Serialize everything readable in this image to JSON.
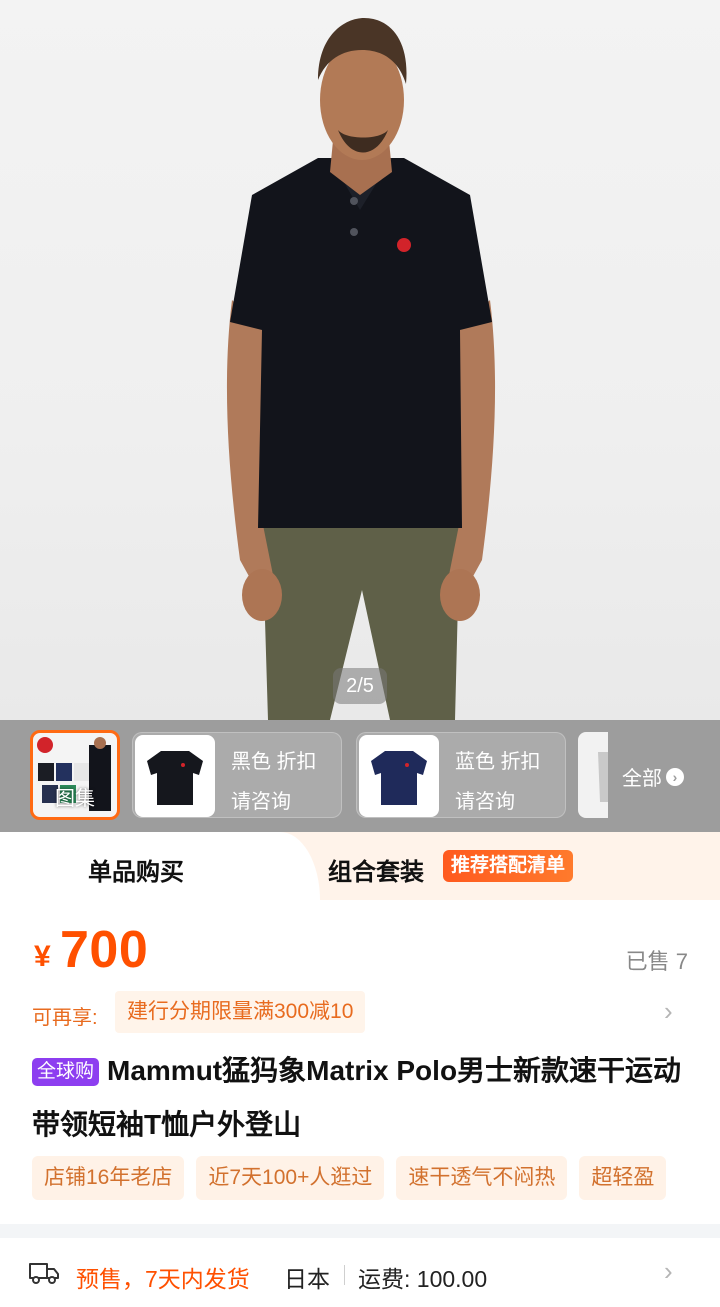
{
  "hero": {
    "counter": "2/5"
  },
  "thumbs": {
    "gallery_label": "图集",
    "variants": [
      {
        "name": "黑色 折扣",
        "note": "请咨询"
      },
      {
        "name": "蓝色 折扣",
        "note": "请咨询"
      }
    ],
    "all_label": "全部"
  },
  "tabs": {
    "single": "单品购买",
    "combo": "组合套装",
    "combo_badge": "推荐搭配清单"
  },
  "price": {
    "symbol": "¥",
    "value": "700",
    "sold": "已售 7"
  },
  "promo": {
    "label": "可再享:",
    "text": "建行分期限量满300减10"
  },
  "title": {
    "badge": "全球购",
    "text": "Mammut猛犸象Matrix Polo男士新款速干运动带领短袖T恤户外登山"
  },
  "tags": [
    "店铺16年老店",
    "近7天100+人逛过",
    "速干透气不闷热",
    "超轻盈"
  ],
  "shipping": {
    "presale": "预售，7天内发货",
    "origin": "日本",
    "fee": "运费:  100.00"
  },
  "colors": {
    "accent": "#ff5000",
    "badge_purple": "#8d3ef0",
    "thumb_strip": "#9d9d9d"
  }
}
